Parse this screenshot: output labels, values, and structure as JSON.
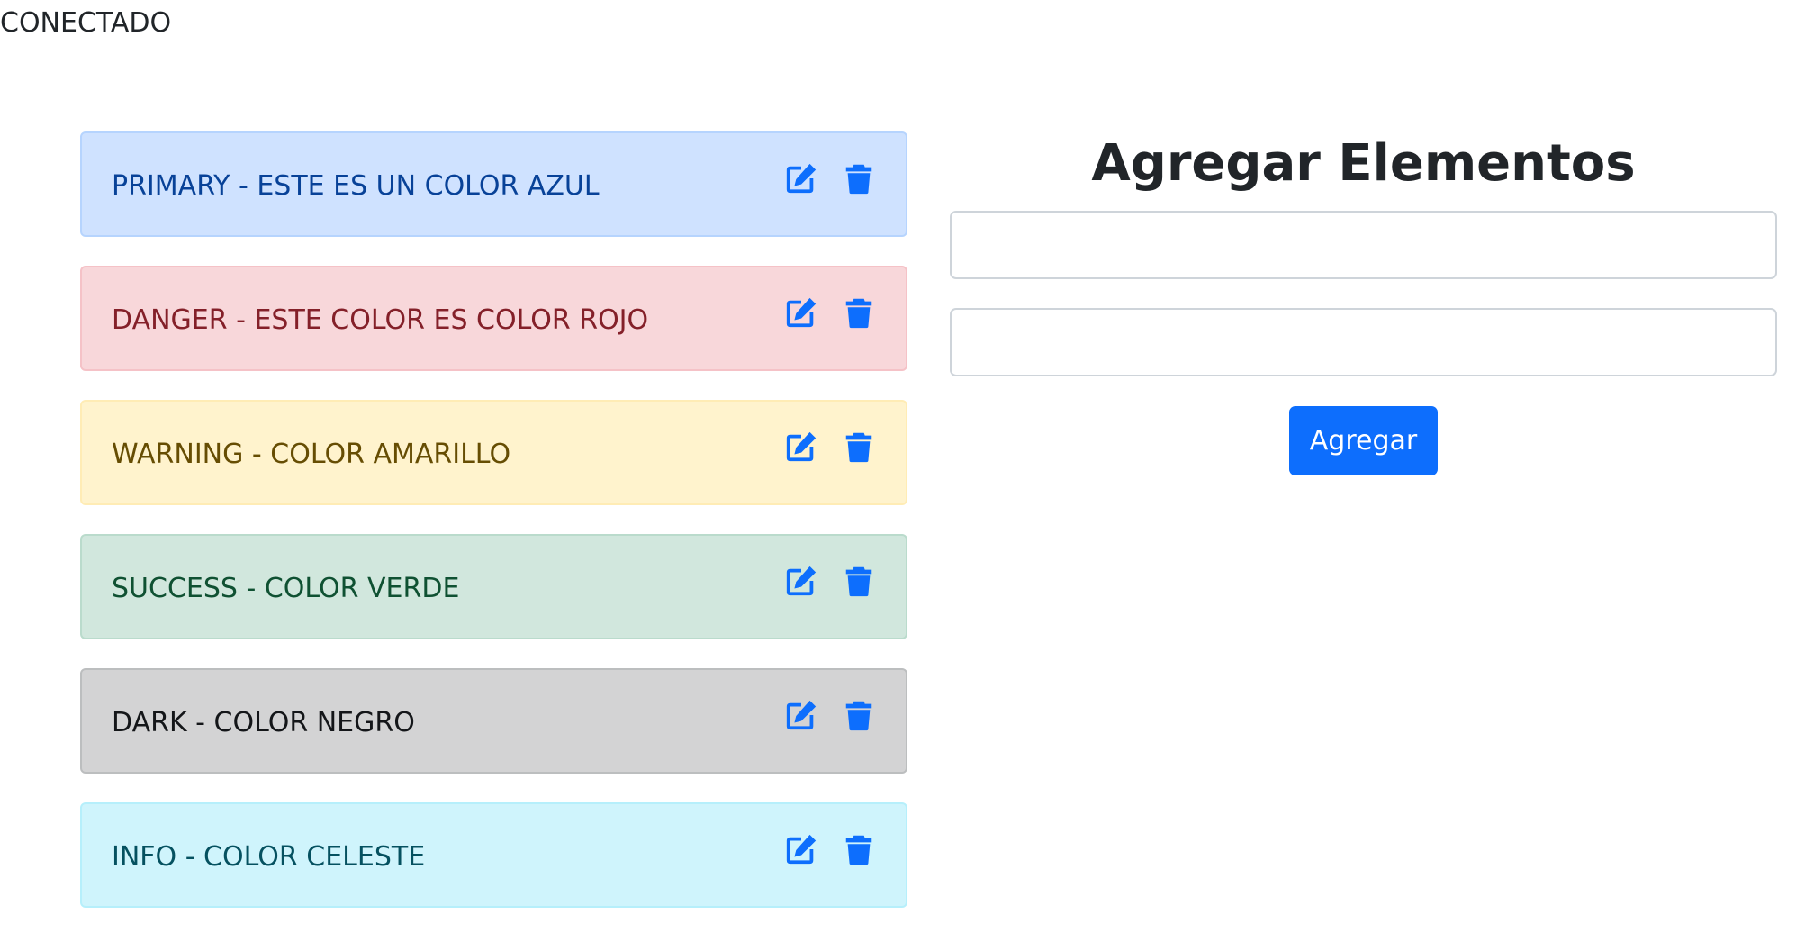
{
  "status": "CONECTADO",
  "items": [
    {
      "variant": "primary",
      "label": "PRIMARY - ESTE ES UN COLOR AZUL",
      "edit_icon": "edit-icon",
      "delete_icon": "trash-icon"
    },
    {
      "variant": "danger",
      "label": "DANGER - ESTE COLOR ES COLOR ROJO",
      "edit_icon": "edit-icon",
      "delete_icon": "trash-icon"
    },
    {
      "variant": "warning",
      "label": "WARNING - COLOR AMARILLO",
      "edit_icon": "edit-icon",
      "delete_icon": "trash-icon"
    },
    {
      "variant": "success",
      "label": "SUCCESS - COLOR VERDE",
      "edit_icon": "edit-icon",
      "delete_icon": "trash-icon"
    },
    {
      "variant": "dark",
      "label": "DARK - COLOR NEGRO",
      "edit_icon": "edit-icon",
      "delete_icon": "trash-icon"
    },
    {
      "variant": "info",
      "label": "INFO - COLOR CELESTE",
      "edit_icon": "edit-icon",
      "delete_icon": "trash-icon"
    }
  ],
  "form": {
    "title": "Agregar Elementos",
    "field_1": {
      "value": "",
      "placeholder": ""
    },
    "field_2": {
      "value": "",
      "placeholder": ""
    },
    "submit_label": "Agregar"
  },
  "colors": {
    "icon": "#0d6efd",
    "button": "#0d6efd"
  }
}
